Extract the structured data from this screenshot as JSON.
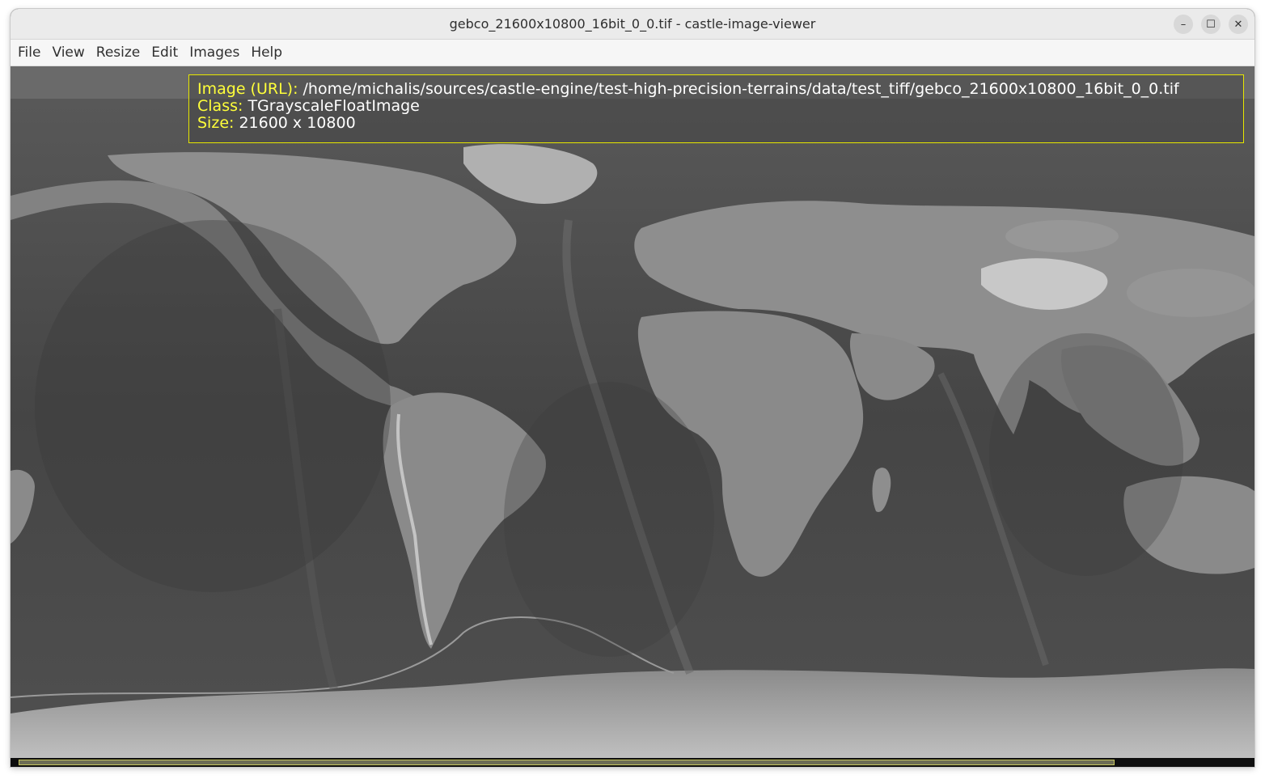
{
  "window": {
    "title": "gebco_21600x10800_16bit_0_0.tif - castle-image-viewer",
    "buttons": {
      "minimize": "–",
      "maximize": "☐",
      "close": "✕"
    }
  },
  "menu": {
    "items": [
      {
        "label": "File"
      },
      {
        "label": "View"
      },
      {
        "label": "Resize"
      },
      {
        "label": "Edit"
      },
      {
        "label": "Images"
      },
      {
        "label": "Help"
      }
    ]
  },
  "info": {
    "url_label": "Image (URL):",
    "url_value": "/home/michalis/sources/castle-engine/test-high-precision-terrains/data/test_tiff/gebco_21600x10800_16bit_0_0.tif",
    "class_label": "Class:",
    "class_value": "TGrayscaleFloatImage",
    "size_label": "Size:",
    "size_value": "21600 x 10800"
  },
  "colors": {
    "info_label": "#ffff3a",
    "info_border": "#e6e600",
    "ocean_deep": "#3b3b3b",
    "ocean_mid": "#555555",
    "land": "#8e8e8e",
    "ice": "#c8c8c8"
  },
  "icons": {
    "minimize": "minimize-icon",
    "maximize": "maximize-icon",
    "close": "close-icon"
  }
}
